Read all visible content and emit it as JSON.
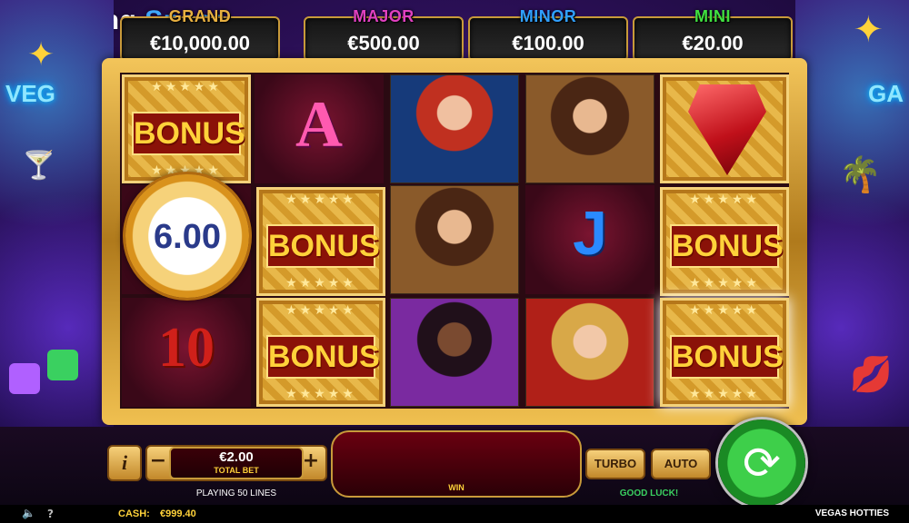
{
  "watermark": {
    "part1": "Gambling",
    "part2": "Space"
  },
  "jackpots": [
    {
      "label": "GRAND",
      "amount": "€10,000.00",
      "color": "#e8b040"
    },
    {
      "label": "MAJOR",
      "amount": "€500.00",
      "color": "#e040c0"
    },
    {
      "label": "MINOR",
      "amount": "€100.00",
      "color": "#30a0ff"
    },
    {
      "label": "MINI",
      "amount": "€20.00",
      "color": "#40e040"
    }
  ],
  "side_art": {
    "left_sign": "VEG",
    "right_sign": "GA"
  },
  "reels": {
    "bonus_text": "BONUS",
    "coin_value": "6.00",
    "symbols": {
      "ace": "A",
      "jack": "J",
      "ten": "10"
    }
  },
  "controls": {
    "info_label": "i",
    "minus_label": "−",
    "plus_label": "+",
    "bet_value": "€2.00",
    "bet_caption": "TOTAL BET",
    "lines_text": "PLAYING 50 LINES",
    "win_label": "WIN",
    "turbo_label": "TURBO",
    "auto_label": "AUTO",
    "good_luck": "GOOD LUCK!"
  },
  "status_bar": {
    "sound_icon": "speaker-icon",
    "help_label": "?",
    "cash_label": "CASH:",
    "cash_value": "€999.40",
    "game_name": "VEGAS HOTTIES"
  }
}
